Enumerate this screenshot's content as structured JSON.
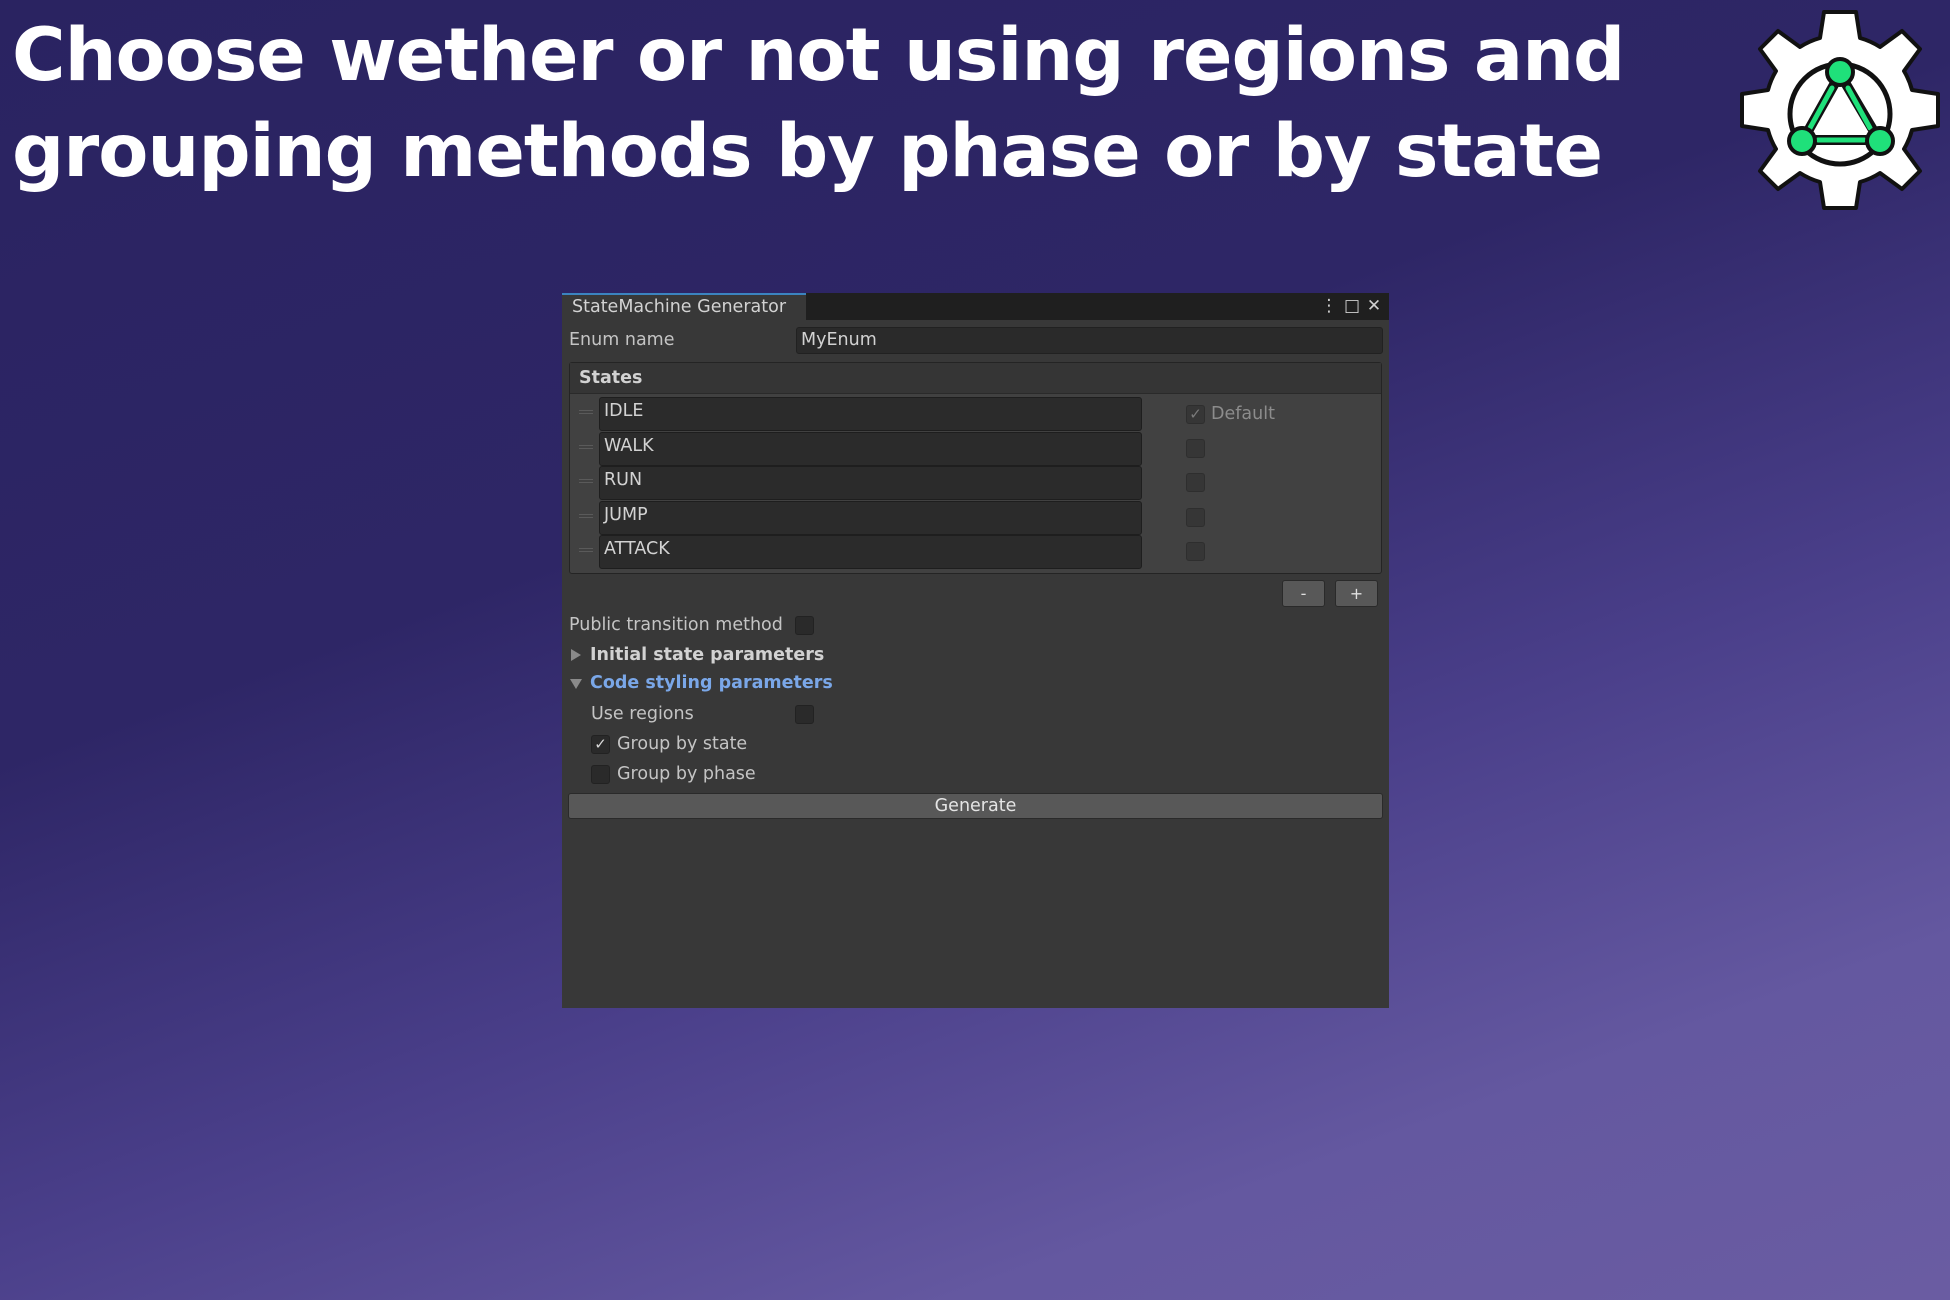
{
  "headline": {
    "line1": "Choose wether or not using regions and",
    "line2": "grouping methods by phase or by state"
  },
  "logo": {
    "icon": "gear-state-machine-logo-icon",
    "accent": "#1fe07a"
  },
  "window": {
    "tab_title": "StateMachine Generator",
    "menu_icon": "⋮",
    "maximize_icon": "□",
    "close_icon": "✕",
    "enum_label": "Enum name",
    "enum_value": "MyEnum",
    "states": {
      "header": "States",
      "default_label": "Default",
      "items": [
        {
          "name": "IDLE",
          "is_default": true
        },
        {
          "name": "WALK",
          "is_default": false
        },
        {
          "name": "RUN",
          "is_default": false
        },
        {
          "name": "JUMP",
          "is_default": false
        },
        {
          "name": "ATTACK",
          "is_default": false
        }
      ],
      "remove_label": "-",
      "add_label": "+"
    },
    "public_transition_label": "Public transition method",
    "public_transition_checked": false,
    "initial_params_label": "Initial state parameters",
    "code_styling_label": "Code styling parameters",
    "code_styling_color": "#7aa7e8",
    "use_regions_label": "Use regions",
    "use_regions_checked": false,
    "group_by_state_label": "Group by state",
    "group_by_state_checked": true,
    "group_by_phase_label": "Group by phase",
    "group_by_phase_checked": false,
    "generate_label": "Generate"
  },
  "colors": {
    "window_bg": "#383838",
    "tab_accent": "#3b84c0",
    "background_dark": "#2a2361",
    "background_light": "#6a5ca2"
  }
}
